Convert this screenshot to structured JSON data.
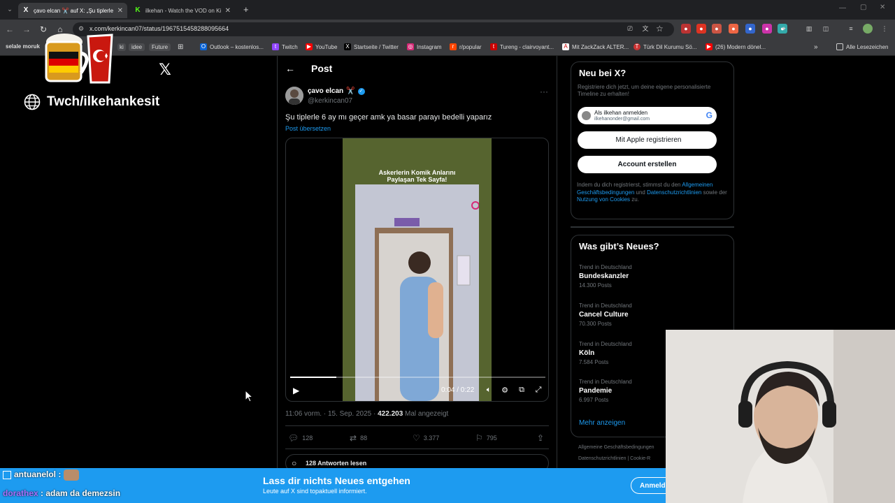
{
  "browser": {
    "tabs": [
      {
        "title": "çavo elcan ✂️ auf X: „Şu tiplerle",
        "active": true
      },
      {
        "title": "ilkehan - Watch the VOD on Ki",
        "active": false
      }
    ],
    "new_tab": "+",
    "url": "x.com/kerkincan07/status/1967515458288095664",
    "bookmarks": [
      "selale moruk",
      "ki",
      "idee",
      "Future",
      "Outlook – kostenlos...",
      "Twitch",
      "YouTube",
      "Startseite / Twitter",
      "Instagram",
      "r/popular",
      "Tureng - clairvoyant...",
      "Mit ZackZack ALTER...",
      "Türk Dil Kurumu Sö...",
      "(26) Modern dönel...",
      "Alle Lesezeichen"
    ]
  },
  "left": {
    "twitch_handle": "Twch/ilkehankesit",
    "x_logo": "𝕏"
  },
  "post": {
    "header_title": "Post",
    "author_name": "çavo elcan",
    "author_emoji": "✂️",
    "author_handle": "@kerkincan07",
    "text": "Şu tiplerle 6 ay mı geçer amk ya basar parayı bedelli yaparız",
    "translate": "Post übersetzen",
    "video_caption_line1": "Askerlerin Komik Anlarını",
    "video_caption_line2": "Paylaşan Tek Sayfa!",
    "video_time": "0:04 / 0:22",
    "video_progress": 0.18,
    "timestamp": "11:06 vorm. · 15. Sep. 2025 · ",
    "views": "422.203",
    "views_label": " Mal angezeigt",
    "replies": "128",
    "reposts": "88",
    "likes": "3.377",
    "bookmarks": "795",
    "read_replies": "128 Antworten lesen"
  },
  "sidebar": {
    "new_title": "Neu bei X?",
    "new_sub": "Registriere dich jetzt, um deine eigene personalisierte Timeline zu erhalten!",
    "google_line1": "Als ilkehan anmelden",
    "google_line2": "ilkehanonder@gmail.com",
    "apple_btn": "Mit Apple registrieren",
    "account_btn": "Account erstellen",
    "legal_prefix": "Indem du dich registrierst, stimmst du den ",
    "legal_link1": "Allgemeinen Geschäftsbedingungen",
    "legal_mid1": " und ",
    "legal_link2": "Datenschutzrichtlinien",
    "legal_mid2": " sowie der ",
    "legal_link3": "Nutzung von Cookies",
    "legal_suffix": " zu.",
    "trends_title": "Was gibt’s Neues?",
    "trends": [
      {
        "context": "Trend in Deutschland",
        "name": "Bundeskanzler",
        "count": "14.300 Posts"
      },
      {
        "context": "Trend in Deutschland",
        "name": "Cancel Culture",
        "count": "70.300 Posts"
      },
      {
        "context": "Trend in Deutschland",
        "name": "Köln",
        "count": "7.584 Posts"
      },
      {
        "context": "Trend in Deutschland",
        "name": "Pandemie",
        "count": "6.997 Posts"
      }
    ],
    "show_more": "Mehr anzeigen",
    "footer_line1": "Allgemeine Geschäftsbedingungen",
    "footer_line2": "Datenschutzrichtlinien  |  Cookie-R"
  },
  "banner": {
    "title": "Lass dir nichts Neues entgehen",
    "subtitle": "Leute auf X sind topaktuell informiert.",
    "login": "Anmeld"
  },
  "chat": [
    {
      "user": "antuanelol",
      "message": ""
    },
    {
      "user": "dorathex",
      "message": "adam da demezsin"
    }
  ],
  "colors": {
    "accent": "#1d9bf0",
    "background": "#000000",
    "border": "#2f3336",
    "muted": "#71767b"
  }
}
